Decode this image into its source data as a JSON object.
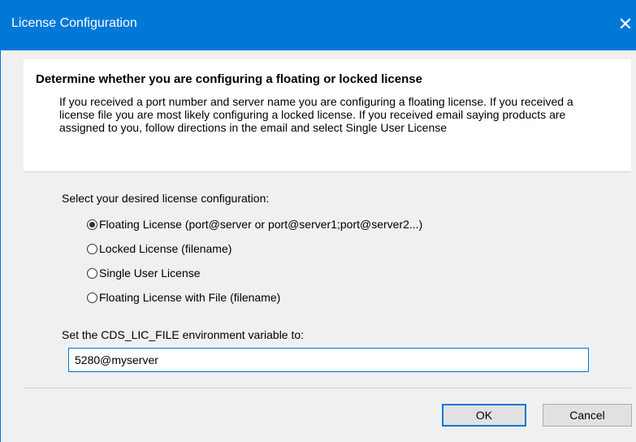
{
  "window": {
    "title": "License Configuration",
    "close_glyph": "✕"
  },
  "header": {
    "title": "Determine whether you are configuring a floating or locked license",
    "description": "If you received a port number and server name you are configuring a floating license. If you received a license file you are most likely configuring a locked license.  If you received email saying products are assigned to you, follow directions in the email and select Single User License"
  },
  "config": {
    "prompt": "Select your desired license configuration:",
    "options": [
      {
        "label": "Floating License (port@server or port@server1;port@server2...)",
        "checked": true
      },
      {
        "label": "Locked License (filename)",
        "checked": false
      },
      {
        "label": "Single User License",
        "checked": false
      },
      {
        "label": "Floating License with File (filename)",
        "checked": false
      }
    ]
  },
  "env": {
    "label": "Set the CDS_LIC_FILE environment variable to:",
    "value": "5280@myserver"
  },
  "buttons": {
    "ok": "OK",
    "cancel": "Cancel"
  },
  "colors": {
    "titlebar": "#0078d7",
    "dialog_bg": "#f0f0f0",
    "focus_border": "#0078d7"
  }
}
